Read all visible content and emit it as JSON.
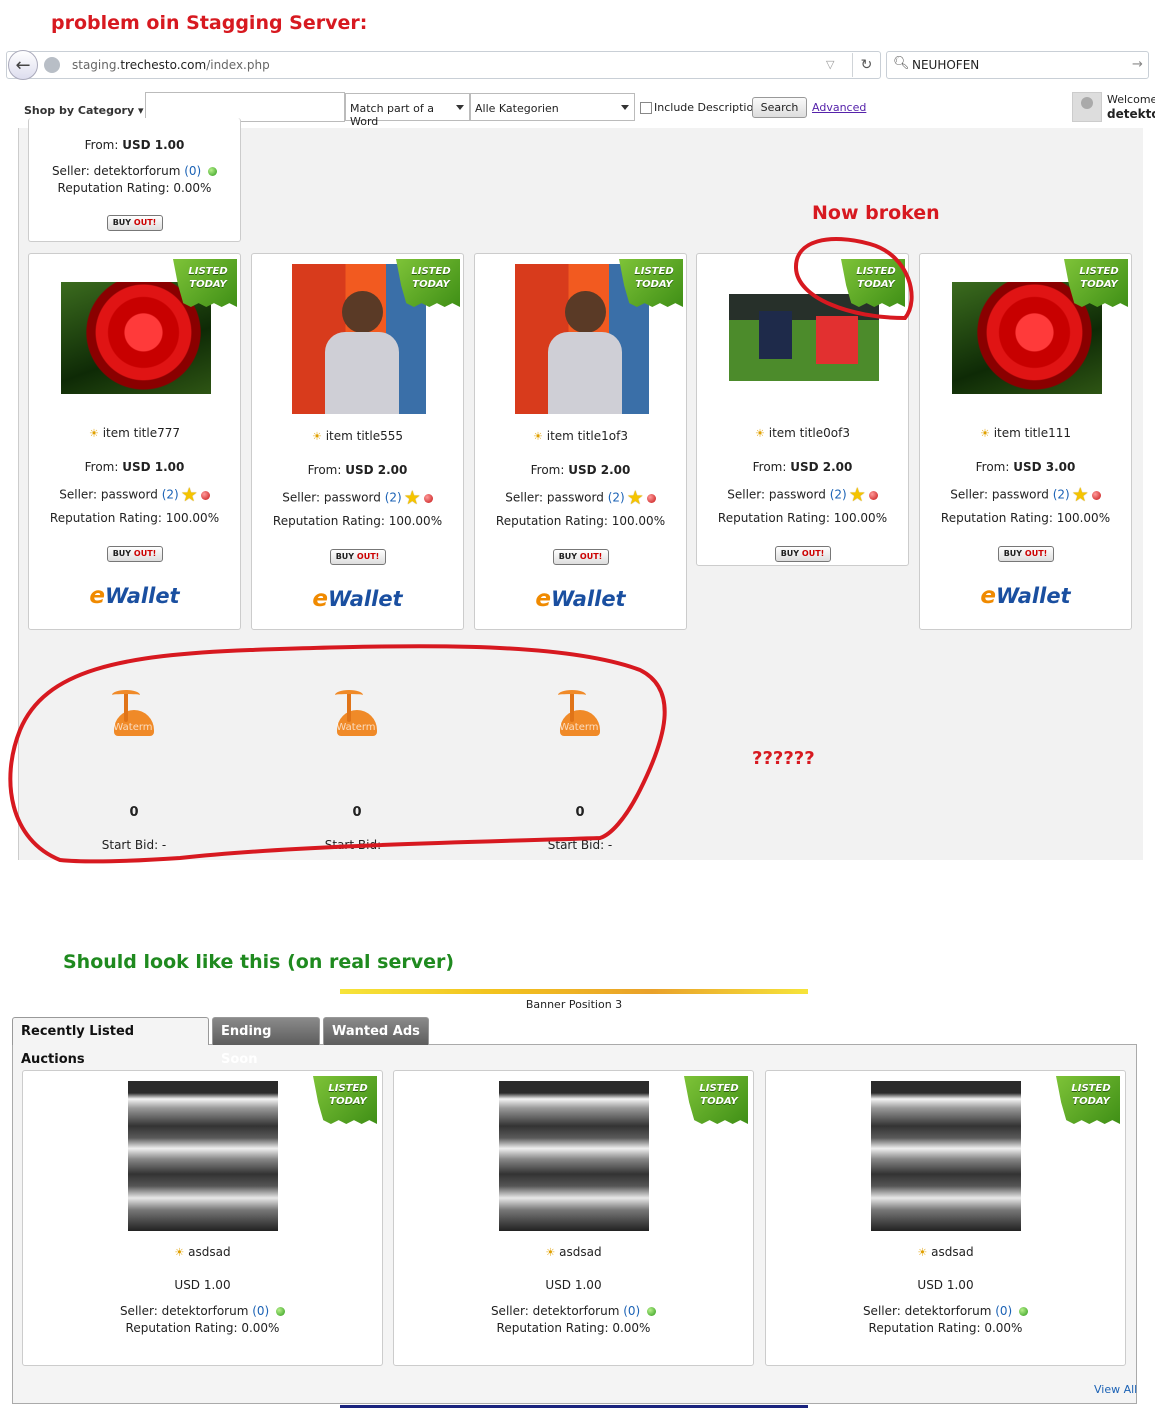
{
  "annotations": {
    "problem_title": "problem oin Stagging Server:",
    "now_broken": "Now broken",
    "question_marks": "??????",
    "should_title": "Should look like this (on real server)",
    "red": "#d71920",
    "green": "#1f8a1f"
  },
  "browser": {
    "url_prefix": "staging.",
    "url_host": "trechesto.com",
    "url_path": "/index.php",
    "search_value": "NEUHOFEN"
  },
  "topnav": {
    "shop_by_category": "Shop by Category",
    "match_option": "Match part of a Word",
    "category_option": "Alle Kategorien",
    "include_description": "Include Description",
    "search_button": "Search",
    "advanced_link": "Advanced",
    "welcome": "Welcome",
    "username": "detekto"
  },
  "staging": {
    "top_card": {
      "from_label": "From:",
      "price": "USD 1.00",
      "seller_label": "Seller:",
      "seller_name": "detektorforum",
      "seller_count": "(0)",
      "reputation": "Reputation Rating: 0.00%",
      "buy_out": "BUY",
      "buy_out_2": "OUT!"
    },
    "ribbon": {
      "line1": "LISTED",
      "line2": "TODAY"
    },
    "items": [
      {
        "title": "item title777",
        "from_label": "From:",
        "price": "USD 1.00",
        "seller_label": "Seller:",
        "seller_name": "password",
        "seller_count": "(2)",
        "reputation": "Reputation Rating: 100.00%",
        "image": "rose-image",
        "wallet": true
      },
      {
        "title": "item title555",
        "from_label": "From:",
        "price": "USD 2.00",
        "seller_label": "Seller:",
        "seller_name": "password",
        "seller_count": "(2)",
        "reputation": "Reputation Rating: 100.00%",
        "image": "man-image",
        "wallet": true
      },
      {
        "title": "item title1of3",
        "from_label": "From:",
        "price": "USD 2.00",
        "seller_label": "Seller:",
        "seller_name": "password",
        "seller_count": "(2)",
        "reputation": "Reputation Rating: 100.00%",
        "image": "man-image",
        "wallet": true
      },
      {
        "title": "item title0of3",
        "from_label": "From:",
        "price": "USD 2.00",
        "seller_label": "Seller:",
        "seller_name": "password",
        "seller_count": "(2)",
        "reputation": "Reputation Rating: 100.00%",
        "image": "soccer-image",
        "wallet": false
      },
      {
        "title": "item title111",
        "from_label": "From:",
        "price": "USD 3.00",
        "seller_label": "Seller:",
        "seller_name": "password",
        "seller_count": "(2)",
        "reputation": "Reputation Rating: 100.00%",
        "image": "rose-image",
        "wallet": true
      }
    ],
    "ewallet_e": "e",
    "ewallet_text": "Wallet",
    "broken_items": [
      {
        "count": "0",
        "start_bid": "Start Bid: -",
        "watermark": "Waterm"
      },
      {
        "count": "0",
        "start_bid": "Start Bid: -",
        "watermark": "Waterm"
      },
      {
        "count": "0",
        "start_bid": "Start Bid: -",
        "watermark": "Waterm"
      }
    ]
  },
  "real": {
    "banner_label": "Banner Position 3",
    "tabs": [
      "Recently Listed Auctions",
      "Ending Soon",
      "Wanted Ads"
    ],
    "items": [
      {
        "title": "asdsad",
        "price": "USD 1.00",
        "seller_label": "Seller:",
        "seller_name": "detektorforum",
        "seller_count": "(0)",
        "reputation": "Reputation Rating: 0.00%"
      },
      {
        "title": "asdsad",
        "price": "USD 1.00",
        "seller_label": "Seller:",
        "seller_name": "detektorforum",
        "seller_count": "(0)",
        "reputation": "Reputation Rating: 0.00%"
      },
      {
        "title": "asdsad",
        "price": "USD 1.00",
        "seller_label": "Seller:",
        "seller_name": "detektorforum",
        "seller_count": "(0)",
        "reputation": "Reputation Rating: 0.00%"
      }
    ],
    "view_all": "View All"
  }
}
